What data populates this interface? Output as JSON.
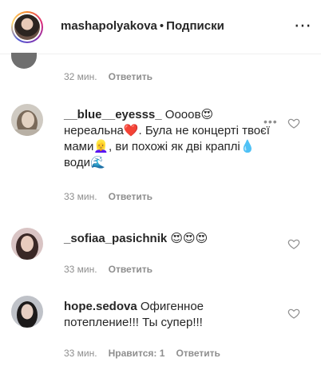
{
  "header": {
    "username": "mashapolyakova",
    "separator": "•",
    "follow_label": "Подписки",
    "more_icon": "more-horizontal-icon"
  },
  "previous_comment": {
    "time": "32 мин.",
    "reply_label": "Ответить"
  },
  "comments": [
    {
      "username": "__blue__eyesss_",
      "text": "Оооов😍 нереальна❤️. Була не концерті твоєї мами👱‍♀️, ви похожі як дві краплі💧 води🌊",
      "time": "33 мин.",
      "reply_label": "Ответить"
    },
    {
      "username": "_sofiaa_pasichnik",
      "text": "😍😍😍",
      "time": "33 мин.",
      "reply_label": "Ответить"
    },
    {
      "username": "hope.sedova",
      "text": "Офигенное потепление!!! Ты супер!!!",
      "time": "33 мин.",
      "likes_label": "Нравится: 1",
      "reply_label": "Ответить"
    }
  ],
  "icons": {
    "like": "heart-outline-icon",
    "options": "more-options-icon"
  },
  "colors": {
    "text_primary": "#262626",
    "text_secondary": "#8e8e8e",
    "story_ring": "#dd2a7b"
  }
}
